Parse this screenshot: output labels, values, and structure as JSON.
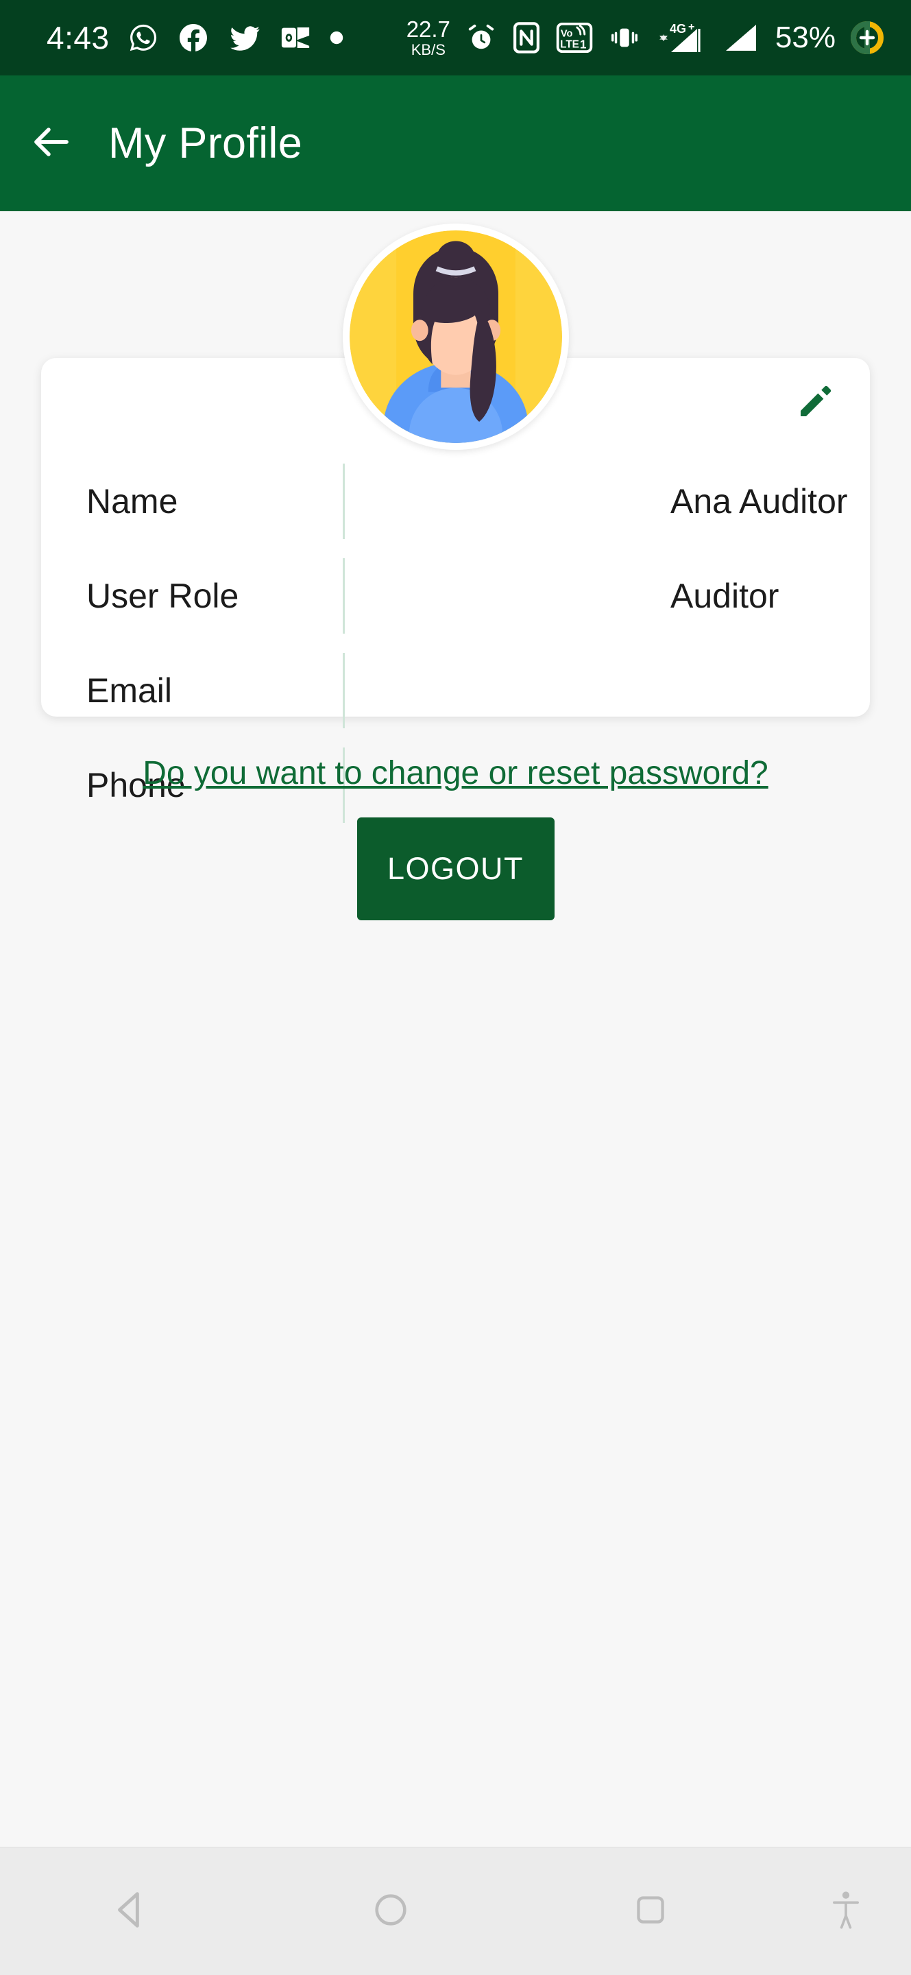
{
  "status_bar": {
    "time": "4:43",
    "app_icons": [
      "whatsapp-icon",
      "facebook-icon",
      "twitter-icon",
      "outlook-icon",
      "dot-indicator-icon"
    ],
    "network_speed_value": "22.7",
    "network_speed_unit": "KB/S",
    "right_icons": [
      "alarm-icon",
      "nfc-icon",
      "volte1-icon",
      "vibrate-icon",
      "4g-plus-signal-icon",
      "signal-icon"
    ],
    "signal_label": "4G",
    "signal_plus": "+",
    "volte_label_top": "Vo",
    "volte_label_bottom": "LTE",
    "volte_sim": "1",
    "battery_percent": "53%",
    "battery_saver_icon": "battery-saver-plus-icon",
    "background_color": "#04401f"
  },
  "app_bar": {
    "back_icon": "arrow-back-icon",
    "title": "My Profile",
    "background_color": "#056431",
    "text_color": "#ffffff"
  },
  "profile": {
    "avatar_icon": "user-avatar-illustration",
    "edit_icon": "pencil-edit-icon",
    "edit_icon_color": "#106b38",
    "fields": [
      {
        "label": "Name",
        "value": "Ana Auditor"
      },
      {
        "label": "User Role",
        "value": "Auditor"
      },
      {
        "label": "Email",
        "value": ""
      },
      {
        "label": "Phone",
        "value": ""
      }
    ]
  },
  "actions": {
    "reset_password_link": "Do you want to change or reset password?",
    "link_color": "#0f6b36",
    "logout_label": "LOGOUT",
    "logout_color": "#0c5c2c"
  },
  "nav_bar": {
    "back_icon": "nav-back-triangle-icon",
    "home_icon": "nav-home-circle-icon",
    "recents_icon": "nav-recents-square-icon",
    "accessibility_icon": "nav-accessibility-icon",
    "background_color": "#ebebeb"
  }
}
